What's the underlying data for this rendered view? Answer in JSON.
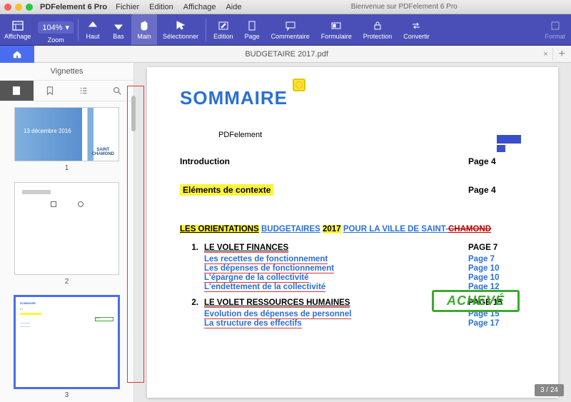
{
  "titlebar": {
    "app": "PDFelement 6 Pro",
    "menu": [
      "Fichier",
      "Edition",
      "Affichage",
      "Aide"
    ],
    "welcome": "Bienvenue sur PDFelement 6 Pro"
  },
  "toolbar": {
    "aff_label": "Affichage",
    "zoom_value": "104%",
    "zoom_label": "Zoom",
    "items": [
      {
        "label": "Haut"
      },
      {
        "label": "Bas"
      },
      {
        "label": "Main"
      },
      {
        "label": "Sélectionner"
      },
      {
        "label": "Edition"
      },
      {
        "label": "Page"
      },
      {
        "label": "Commentaire"
      },
      {
        "label": "Formulaire"
      },
      {
        "label": "Protection"
      },
      {
        "label": "Convertir"
      }
    ],
    "format_label": "Format"
  },
  "tabbar": {
    "doc": "BUDGETAIRE 2017.pdf"
  },
  "sidebar": {
    "title": "Vignettes",
    "thumbs": [
      "1",
      "2",
      "3"
    ],
    "t1_date": "13 décembre 2016",
    "t1_logo": "SAINT\nCHAMOND"
  },
  "doc": {
    "h1": "SOMMAIRE",
    "pf": "PDFelement",
    "intro": {
      "label": "Introduction",
      "page": "Page 4"
    },
    "ctx": {
      "label": "Eléments de contexte",
      "page": "Page 4"
    },
    "stamp": "ACHEVÉ",
    "orient": {
      "p1": "LES ORIENTATIONS",
      "p2": "BUDGETAIRES",
      "p3": "2017",
      "p4": "POUR LA VILLE DE SAINT-",
      "p5": "CHAMOND"
    },
    "sec1": {
      "num": "1.",
      "title": "LE VOLET FINANCES",
      "page": "PAGE 7"
    },
    "sec1_items": [
      {
        "t": "Les recettes de fonctionnement",
        "p": "Page 7"
      },
      {
        "t": "Les dépenses de fonctionnement",
        "p": "Page 10"
      },
      {
        "t": "L'épargne de la collectivité",
        "p": "Page 10"
      },
      {
        "t": "L'endettement de la collectivité",
        "p": "Page 12"
      }
    ],
    "sec2": {
      "num": "2.",
      "title": "LE VOLET RESSOURCES HUMAINES",
      "page": "PAGE 15"
    },
    "sec2_items": [
      {
        "t": "Evolution des dépenses de personnel",
        "p": "Page 15"
      },
      {
        "t": "La structure des effectifs",
        "p": "Page 17"
      }
    ]
  },
  "pager": "3 / 24"
}
